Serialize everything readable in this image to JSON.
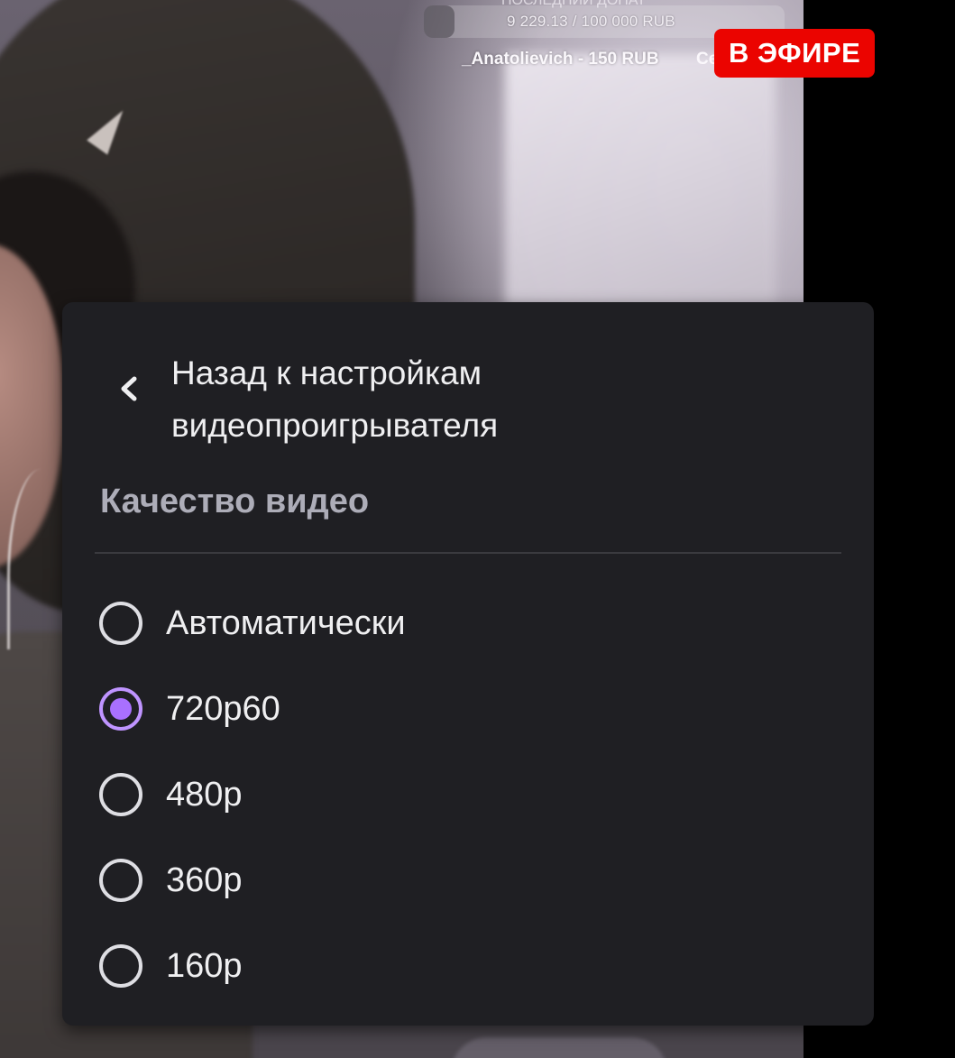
{
  "stream_overlay": {
    "donation_top_line": "ПОСЛЕДНИЙ ДОНАТ",
    "donation_total": "9 229.13 / 100 000 RUB",
    "last_donation": "_Anatolievich - 150 RUB",
    "next_donation_partial": "Се",
    "live_badge": "В ЭФИРЕ"
  },
  "menu": {
    "back_label": "Назад к настройкам видеопроигрывателя",
    "back_icon": "chevron-left-icon",
    "section_title": "Качество видео",
    "selected": "720p60",
    "options": [
      {
        "label": "Автоматически",
        "selected": false
      },
      {
        "label": "720p60",
        "selected": true
      },
      {
        "label": "480p",
        "selected": false
      },
      {
        "label": "360p",
        "selected": false
      },
      {
        "label": "160p",
        "selected": false
      }
    ]
  },
  "colors": {
    "accent": "#a970ff",
    "live_red": "#eb0400",
    "menu_bg": "#1f1f23"
  }
}
